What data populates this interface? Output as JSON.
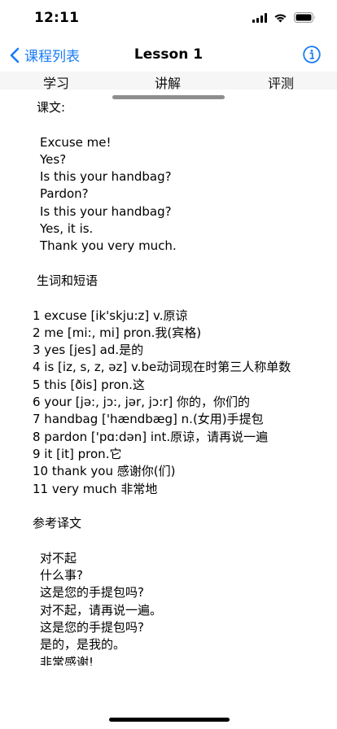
{
  "status_bar": {
    "time": "12:11"
  },
  "nav": {
    "back_label": "课程列表",
    "title": "Lesson 1"
  },
  "tabs": [
    {
      "label": "学习"
    },
    {
      "label": "讲解"
    },
    {
      "label": "评测"
    }
  ],
  "lesson": {
    "text_heading": "课文:",
    "text_lines": [
      "Excuse me!",
      "Yes?",
      "Is this your handbag?",
      "Pardon?",
      "Is this your handbag?",
      "Yes, it is.",
      "Thank you very much."
    ],
    "vocab_heading": "生词和短语",
    "vocab_lines": [
      "1 excuse [ik'skju:z] v.原谅",
      "2 me [mi:, mi] pron.我(宾格)",
      "3 yes [jes] ad.是的",
      "4 is [iz, s, z, əz] v.be动词现在时第三人称单数",
      "5 this [ðis] pron.这",
      "6 your [jə:, jɔ:, jər, jɔ:r] 你的，你们的",
      "7 handbag ['hændbæg] n.(女用)手提包",
      "8 pardon ['pɑ:dən] int.原谅，请再说一遍",
      "9 it [it] pron.它",
      "10 thank you 感谢你(们)",
      "11 very much 非常地"
    ],
    "translation_heading": "参考译文",
    "translation_lines": [
      "对不起",
      "什么事?",
      "这是您的手提包吗?",
      "对不起，请再说一遍。",
      "这是您的手提包吗?",
      "是的，是我的。",
      "非常感谢!"
    ]
  }
}
